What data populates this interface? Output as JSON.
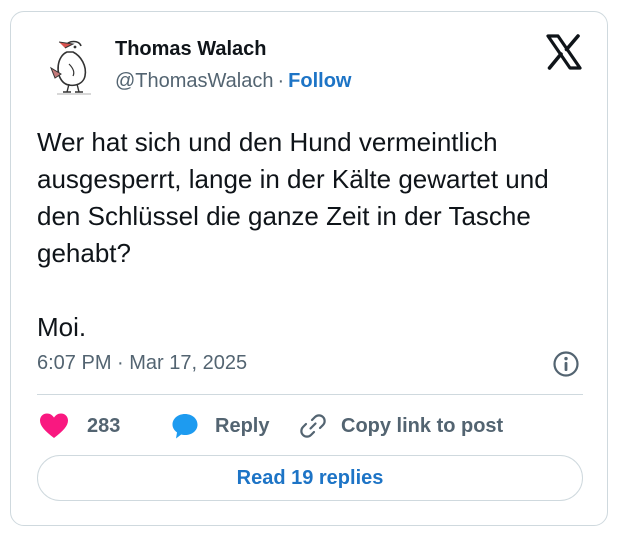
{
  "author": {
    "name": "Thomas Walach",
    "handle": "@ThomasWalach",
    "separator": "·",
    "follow_label": "Follow"
  },
  "tweet": {
    "text_lines": [
      "Wer hat sich und den Hund vermeintlich ausgesperrt, lange in der Kälte gewartet und den Schlüssel die ganze Zeit in der Tasche gehabt?",
      "Moi."
    ],
    "timestamp": "6:07 PM · Mar 17, 2025"
  },
  "actions": {
    "like_count": "283",
    "reply_label": "Reply",
    "copy_link_label": "Copy link to post"
  },
  "read_replies_label": "Read 19 replies",
  "icons": {
    "platform": "x-logo-icon",
    "avatar": "bird-sketch-avatar",
    "info": "info-icon",
    "like": "heart-icon",
    "reply": "speech-bubble-icon",
    "copy": "link-icon"
  },
  "colors": {
    "accent_blue": "#1d74c6",
    "like_red": "#f91880",
    "reply_blue": "#1d9bf0",
    "muted_text": "#536471",
    "border": "#cfd9de"
  }
}
